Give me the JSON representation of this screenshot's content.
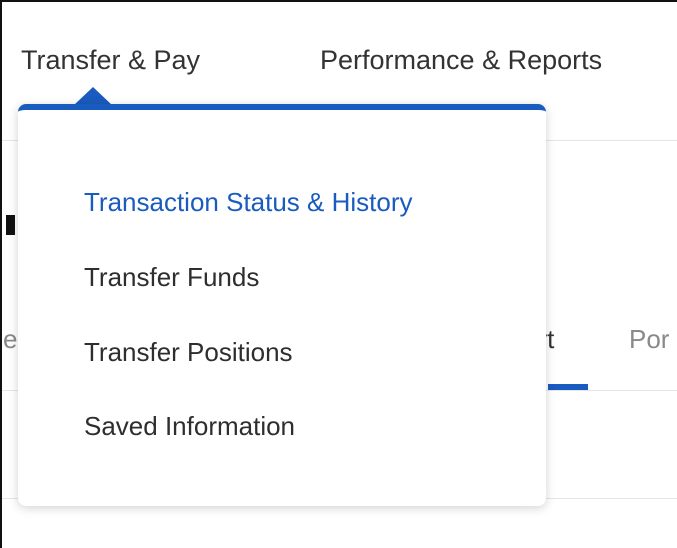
{
  "nav": {
    "items": [
      {
        "label": "Transfer & Pay",
        "expanded": true
      },
      {
        "label": "Performance & Reports",
        "expanded": false
      }
    ]
  },
  "dropdown": {
    "accent_color": "#1a5bbf",
    "items": [
      {
        "label": "Transaction Status & History",
        "active": true
      },
      {
        "label": "Transfer Funds",
        "active": false
      },
      {
        "label": "Transfer Positions",
        "active": false
      },
      {
        "label": "Saved Information",
        "active": false
      }
    ]
  },
  "background": {
    "tab_partial_left": "e",
    "tab_active_partial": "ort",
    "tab_next_partial": "Por"
  },
  "colors": {
    "text": "#333333",
    "link_active": "#1a5bbf",
    "muted": "#8a8a8a"
  }
}
